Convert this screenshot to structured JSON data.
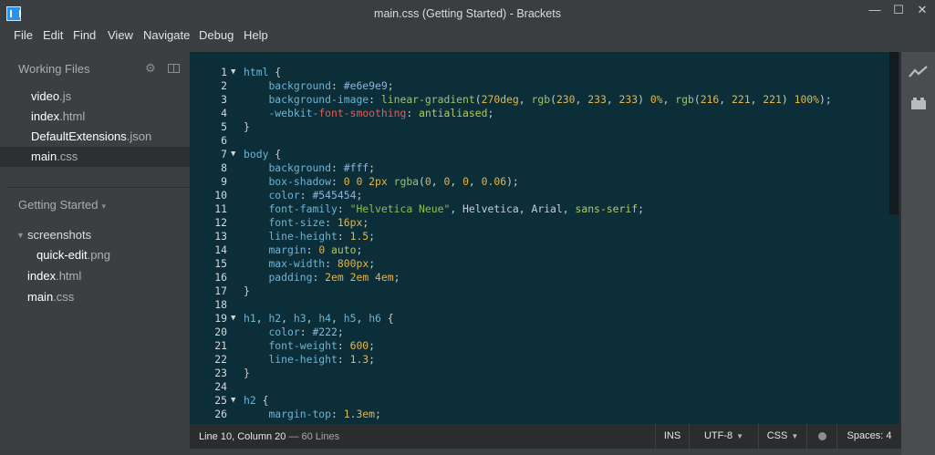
{
  "window": {
    "title": "main.css (Getting Started) - Brackets",
    "minimize": "—",
    "maximize": "☐",
    "close": "✕"
  },
  "menu": [
    "File",
    "Edit",
    "Find",
    "View",
    "Navigate",
    "Debug",
    "Help"
  ],
  "working_files": {
    "header": "Working Files",
    "items": [
      {
        "name": "video",
        "ext": ".js",
        "active": false
      },
      {
        "name": "index",
        "ext": ".html",
        "active": false
      },
      {
        "name": "DefaultExtensions",
        "ext": ".json",
        "active": false
      },
      {
        "name": "main",
        "ext": ".css",
        "active": true
      }
    ]
  },
  "project": {
    "name": "Getting Started",
    "caret": "▾",
    "tree": [
      {
        "type": "folder",
        "name": "screenshots",
        "caret": "▼"
      },
      {
        "type": "file",
        "name": "quick-edit",
        "ext": ".png",
        "indent": 1
      },
      {
        "type": "file",
        "name": "index",
        "ext": ".html",
        "indent": 0
      },
      {
        "type": "file",
        "name": "main",
        "ext": ".css",
        "indent": 0
      }
    ]
  },
  "editor": {
    "lines": [
      {
        "n": "1",
        "fold": "▼",
        "tokens": [
          [
            "t-sel",
            "html"
          ],
          [
            "t-punc",
            " {"
          ]
        ]
      },
      {
        "n": "2",
        "tokens": [
          [
            "t-punc",
            "    "
          ],
          [
            "t-prop",
            "background"
          ],
          [
            "t-punc",
            ": "
          ],
          [
            "t-hex",
            "#e6e9e9"
          ],
          [
            "t-punc",
            ";"
          ]
        ]
      },
      {
        "n": "3",
        "tokens": [
          [
            "t-punc",
            "    "
          ],
          [
            "t-prop",
            "background-image"
          ],
          [
            "t-punc",
            ": "
          ],
          [
            "t-func",
            "linear-gradient"
          ],
          [
            "t-punc",
            "("
          ],
          [
            "t-num",
            "270deg"
          ],
          [
            "t-punc",
            ", "
          ],
          [
            "t-func",
            "rgb"
          ],
          [
            "t-punc",
            "("
          ],
          [
            "t-num",
            "230"
          ],
          [
            "t-punc",
            ", "
          ],
          [
            "t-num",
            "233"
          ],
          [
            "t-punc",
            ", "
          ],
          [
            "t-num",
            "233"
          ],
          [
            "t-punc",
            ") "
          ],
          [
            "t-num",
            "0%"
          ],
          [
            "t-punc",
            ", "
          ],
          [
            "t-func",
            "rgb"
          ],
          [
            "t-punc",
            "("
          ],
          [
            "t-num",
            "216"
          ],
          [
            "t-punc",
            ", "
          ],
          [
            "t-num",
            "221"
          ],
          [
            "t-punc",
            ", "
          ],
          [
            "t-num",
            "221"
          ],
          [
            "t-punc",
            ") "
          ],
          [
            "t-num",
            "100%"
          ],
          [
            "t-punc",
            ");"
          ]
        ]
      },
      {
        "n": "4",
        "tokens": [
          [
            "t-punc",
            "    "
          ],
          [
            "t-prop",
            "-webkit-"
          ],
          [
            "t-vendor",
            "font-smoothing"
          ],
          [
            "t-punc",
            ": "
          ],
          [
            "t-val",
            "antialiased"
          ],
          [
            "t-punc",
            ";"
          ]
        ]
      },
      {
        "n": "5",
        "tokens": [
          [
            "t-punc",
            "}"
          ]
        ]
      },
      {
        "n": "6",
        "tokens": []
      },
      {
        "n": "7",
        "fold": "▼",
        "tokens": [
          [
            "t-sel",
            "body"
          ],
          [
            "t-punc",
            " {"
          ]
        ]
      },
      {
        "n": "8",
        "tokens": [
          [
            "t-punc",
            "    "
          ],
          [
            "t-prop",
            "background"
          ],
          [
            "t-punc",
            ": "
          ],
          [
            "t-hex",
            "#fff"
          ],
          [
            "t-punc",
            ";"
          ]
        ]
      },
      {
        "n": "9",
        "tokens": [
          [
            "t-punc",
            "    "
          ],
          [
            "t-prop",
            "box-shadow"
          ],
          [
            "t-punc",
            ": "
          ],
          [
            "t-num",
            "0 0 2px"
          ],
          [
            "t-punc",
            " "
          ],
          [
            "t-func",
            "rgba"
          ],
          [
            "t-punc",
            "("
          ],
          [
            "t-num",
            "0"
          ],
          [
            "t-punc",
            ", "
          ],
          [
            "t-num",
            "0"
          ],
          [
            "t-punc",
            ", "
          ],
          [
            "t-num",
            "0"
          ],
          [
            "t-punc",
            ", "
          ],
          [
            "t-num",
            "0.06"
          ],
          [
            "t-punc",
            ");"
          ]
        ]
      },
      {
        "n": "10",
        "tokens": [
          [
            "t-punc",
            "    "
          ],
          [
            "t-prop",
            "color"
          ],
          [
            "t-punc",
            ": "
          ],
          [
            "t-hex",
            "#545454"
          ],
          [
            "t-punc",
            ";"
          ]
        ]
      },
      {
        "n": "11",
        "tokens": [
          [
            "t-punc",
            "    "
          ],
          [
            "t-prop",
            "font-family"
          ],
          [
            "t-punc",
            ": "
          ],
          [
            "t-str",
            "\"Helvetica Neue\""
          ],
          [
            "t-punc",
            ", Helvetica, Arial, "
          ],
          [
            "t-val",
            "sans-serif"
          ],
          [
            "t-punc",
            ";"
          ]
        ]
      },
      {
        "n": "12",
        "tokens": [
          [
            "t-punc",
            "    "
          ],
          [
            "t-prop",
            "font-size"
          ],
          [
            "t-punc",
            ": "
          ],
          [
            "t-num",
            "16px"
          ],
          [
            "t-punc",
            ";"
          ]
        ]
      },
      {
        "n": "13",
        "tokens": [
          [
            "t-punc",
            "    "
          ],
          [
            "t-prop",
            "line-height"
          ],
          [
            "t-punc",
            ": "
          ],
          [
            "t-num",
            "1.5"
          ],
          [
            "t-punc",
            ";"
          ]
        ]
      },
      {
        "n": "14",
        "tokens": [
          [
            "t-punc",
            "    "
          ],
          [
            "t-prop",
            "margin"
          ],
          [
            "t-punc",
            ": "
          ],
          [
            "t-num",
            "0"
          ],
          [
            "t-punc",
            " "
          ],
          [
            "t-val",
            "auto"
          ],
          [
            "t-punc",
            ";"
          ]
        ]
      },
      {
        "n": "15",
        "tokens": [
          [
            "t-punc",
            "    "
          ],
          [
            "t-prop",
            "max-width"
          ],
          [
            "t-punc",
            ": "
          ],
          [
            "t-num",
            "800px"
          ],
          [
            "t-punc",
            ";"
          ]
        ]
      },
      {
        "n": "16",
        "tokens": [
          [
            "t-punc",
            "    "
          ],
          [
            "t-prop",
            "padding"
          ],
          [
            "t-punc",
            ": "
          ],
          [
            "t-num",
            "2em 2em 4em"
          ],
          [
            "t-punc",
            ";"
          ]
        ]
      },
      {
        "n": "17",
        "tokens": [
          [
            "t-punc",
            "}"
          ]
        ]
      },
      {
        "n": "18",
        "tokens": []
      },
      {
        "n": "19",
        "fold": "▼",
        "tokens": [
          [
            "t-sel",
            "h1"
          ],
          [
            "t-punc",
            ", "
          ],
          [
            "t-sel",
            "h2"
          ],
          [
            "t-punc",
            ", "
          ],
          [
            "t-sel",
            "h3"
          ],
          [
            "t-punc",
            ", "
          ],
          [
            "t-sel",
            "h4"
          ],
          [
            "t-punc",
            ", "
          ],
          [
            "t-sel",
            "h5"
          ],
          [
            "t-punc",
            ", "
          ],
          [
            "t-sel",
            "h6"
          ],
          [
            "t-punc",
            " {"
          ]
        ]
      },
      {
        "n": "20",
        "tokens": [
          [
            "t-punc",
            "    "
          ],
          [
            "t-prop",
            "color"
          ],
          [
            "t-punc",
            ": "
          ],
          [
            "t-hex",
            "#222"
          ],
          [
            "t-punc",
            ";"
          ]
        ]
      },
      {
        "n": "21",
        "tokens": [
          [
            "t-punc",
            "    "
          ],
          [
            "t-prop",
            "font-weight"
          ],
          [
            "t-punc",
            ": "
          ],
          [
            "t-num",
            "600"
          ],
          [
            "t-punc",
            ";"
          ]
        ]
      },
      {
        "n": "22",
        "tokens": [
          [
            "t-punc",
            "    "
          ],
          [
            "t-prop",
            "line-height"
          ],
          [
            "t-punc",
            ": "
          ],
          [
            "t-num",
            "1.3"
          ],
          [
            "t-punc",
            ";"
          ]
        ]
      },
      {
        "n": "23",
        "tokens": [
          [
            "t-punc",
            "}"
          ]
        ]
      },
      {
        "n": "24",
        "tokens": []
      },
      {
        "n": "25",
        "fold": "▼",
        "tokens": [
          [
            "t-sel",
            "h2"
          ],
          [
            "t-punc",
            " {"
          ]
        ]
      },
      {
        "n": "26",
        "tokens": [
          [
            "t-punc",
            "    "
          ],
          [
            "t-prop",
            "margin-top"
          ],
          [
            "t-punc",
            ": "
          ],
          [
            "t-num",
            "1.3em"
          ],
          [
            "t-punc",
            ";"
          ]
        ]
      }
    ]
  },
  "status": {
    "position": "Line 10, Column 20",
    "lines": " — 60 Lines",
    "mode": "INS",
    "encoding": "UTF-8",
    "language": "CSS",
    "spaces": "Spaces: 4",
    "caret": "▼"
  },
  "right_toolbar": [
    {
      "icon": "live-preview-icon",
      "glyph": "⌇"
    },
    {
      "icon": "extension-manager-icon",
      "glyph": "▬"
    }
  ]
}
